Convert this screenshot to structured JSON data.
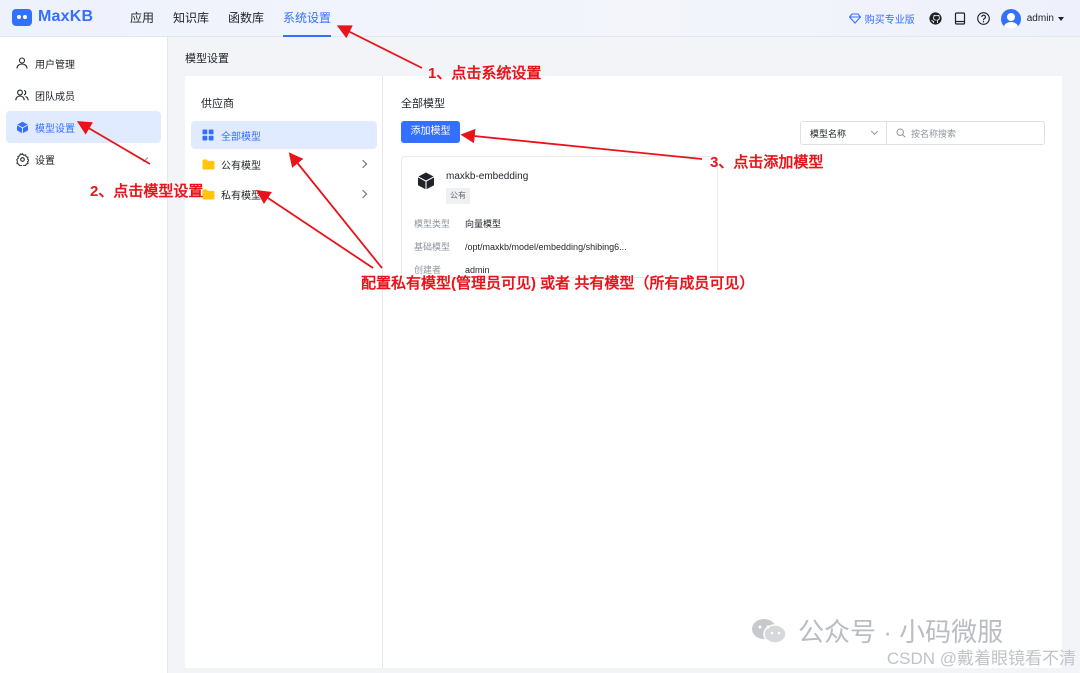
{
  "app": {
    "logo_text": "MaxKB"
  },
  "nav": {
    "items": [
      {
        "label": "应用"
      },
      {
        "label": "知识库"
      },
      {
        "label": "函数库"
      },
      {
        "label": "系统设置"
      }
    ],
    "active_index": 3
  },
  "header": {
    "buy_label": "购买专业版",
    "user_name": "admin"
  },
  "sidebar": {
    "items": [
      {
        "label": "用户管理"
      },
      {
        "label": "团队成员"
      },
      {
        "label": "模型设置"
      },
      {
        "label": "设置"
      }
    ]
  },
  "page": {
    "title": "模型设置"
  },
  "provider": {
    "title": "供应商",
    "items": [
      {
        "label": "全部模型"
      },
      {
        "label": "公有模型"
      },
      {
        "label": "私有模型"
      }
    ]
  },
  "content": {
    "title": "全部模型",
    "add_button": "添加模型",
    "search_select": "模型名称",
    "search_placeholder": "按名称搜索"
  },
  "card": {
    "name": "maxkb-embedding",
    "tag": "公有",
    "rows": [
      {
        "key": "模型类型",
        "value": "向量模型"
      },
      {
        "key": "基础模型",
        "value": "/opt/maxkb/model/embedding/shibing6..."
      },
      {
        "key": "创建者",
        "value": "admin"
      }
    ]
  },
  "annotations": {
    "step1": "1、点击系统设置",
    "step2": "2、点击模型设置",
    "step3": "3、点击添加模型",
    "note": "配置私有模型(管理员可见) 或者 共有模型（所有成员可见）"
  },
  "watermark": {
    "main": "公众号 · 小码微服",
    "csdn": "CSDN @戴着眼镜看不清"
  },
  "colors": {
    "accent": "#3370ff",
    "annotation": "#e8141b",
    "folder": "#ffc60a"
  }
}
